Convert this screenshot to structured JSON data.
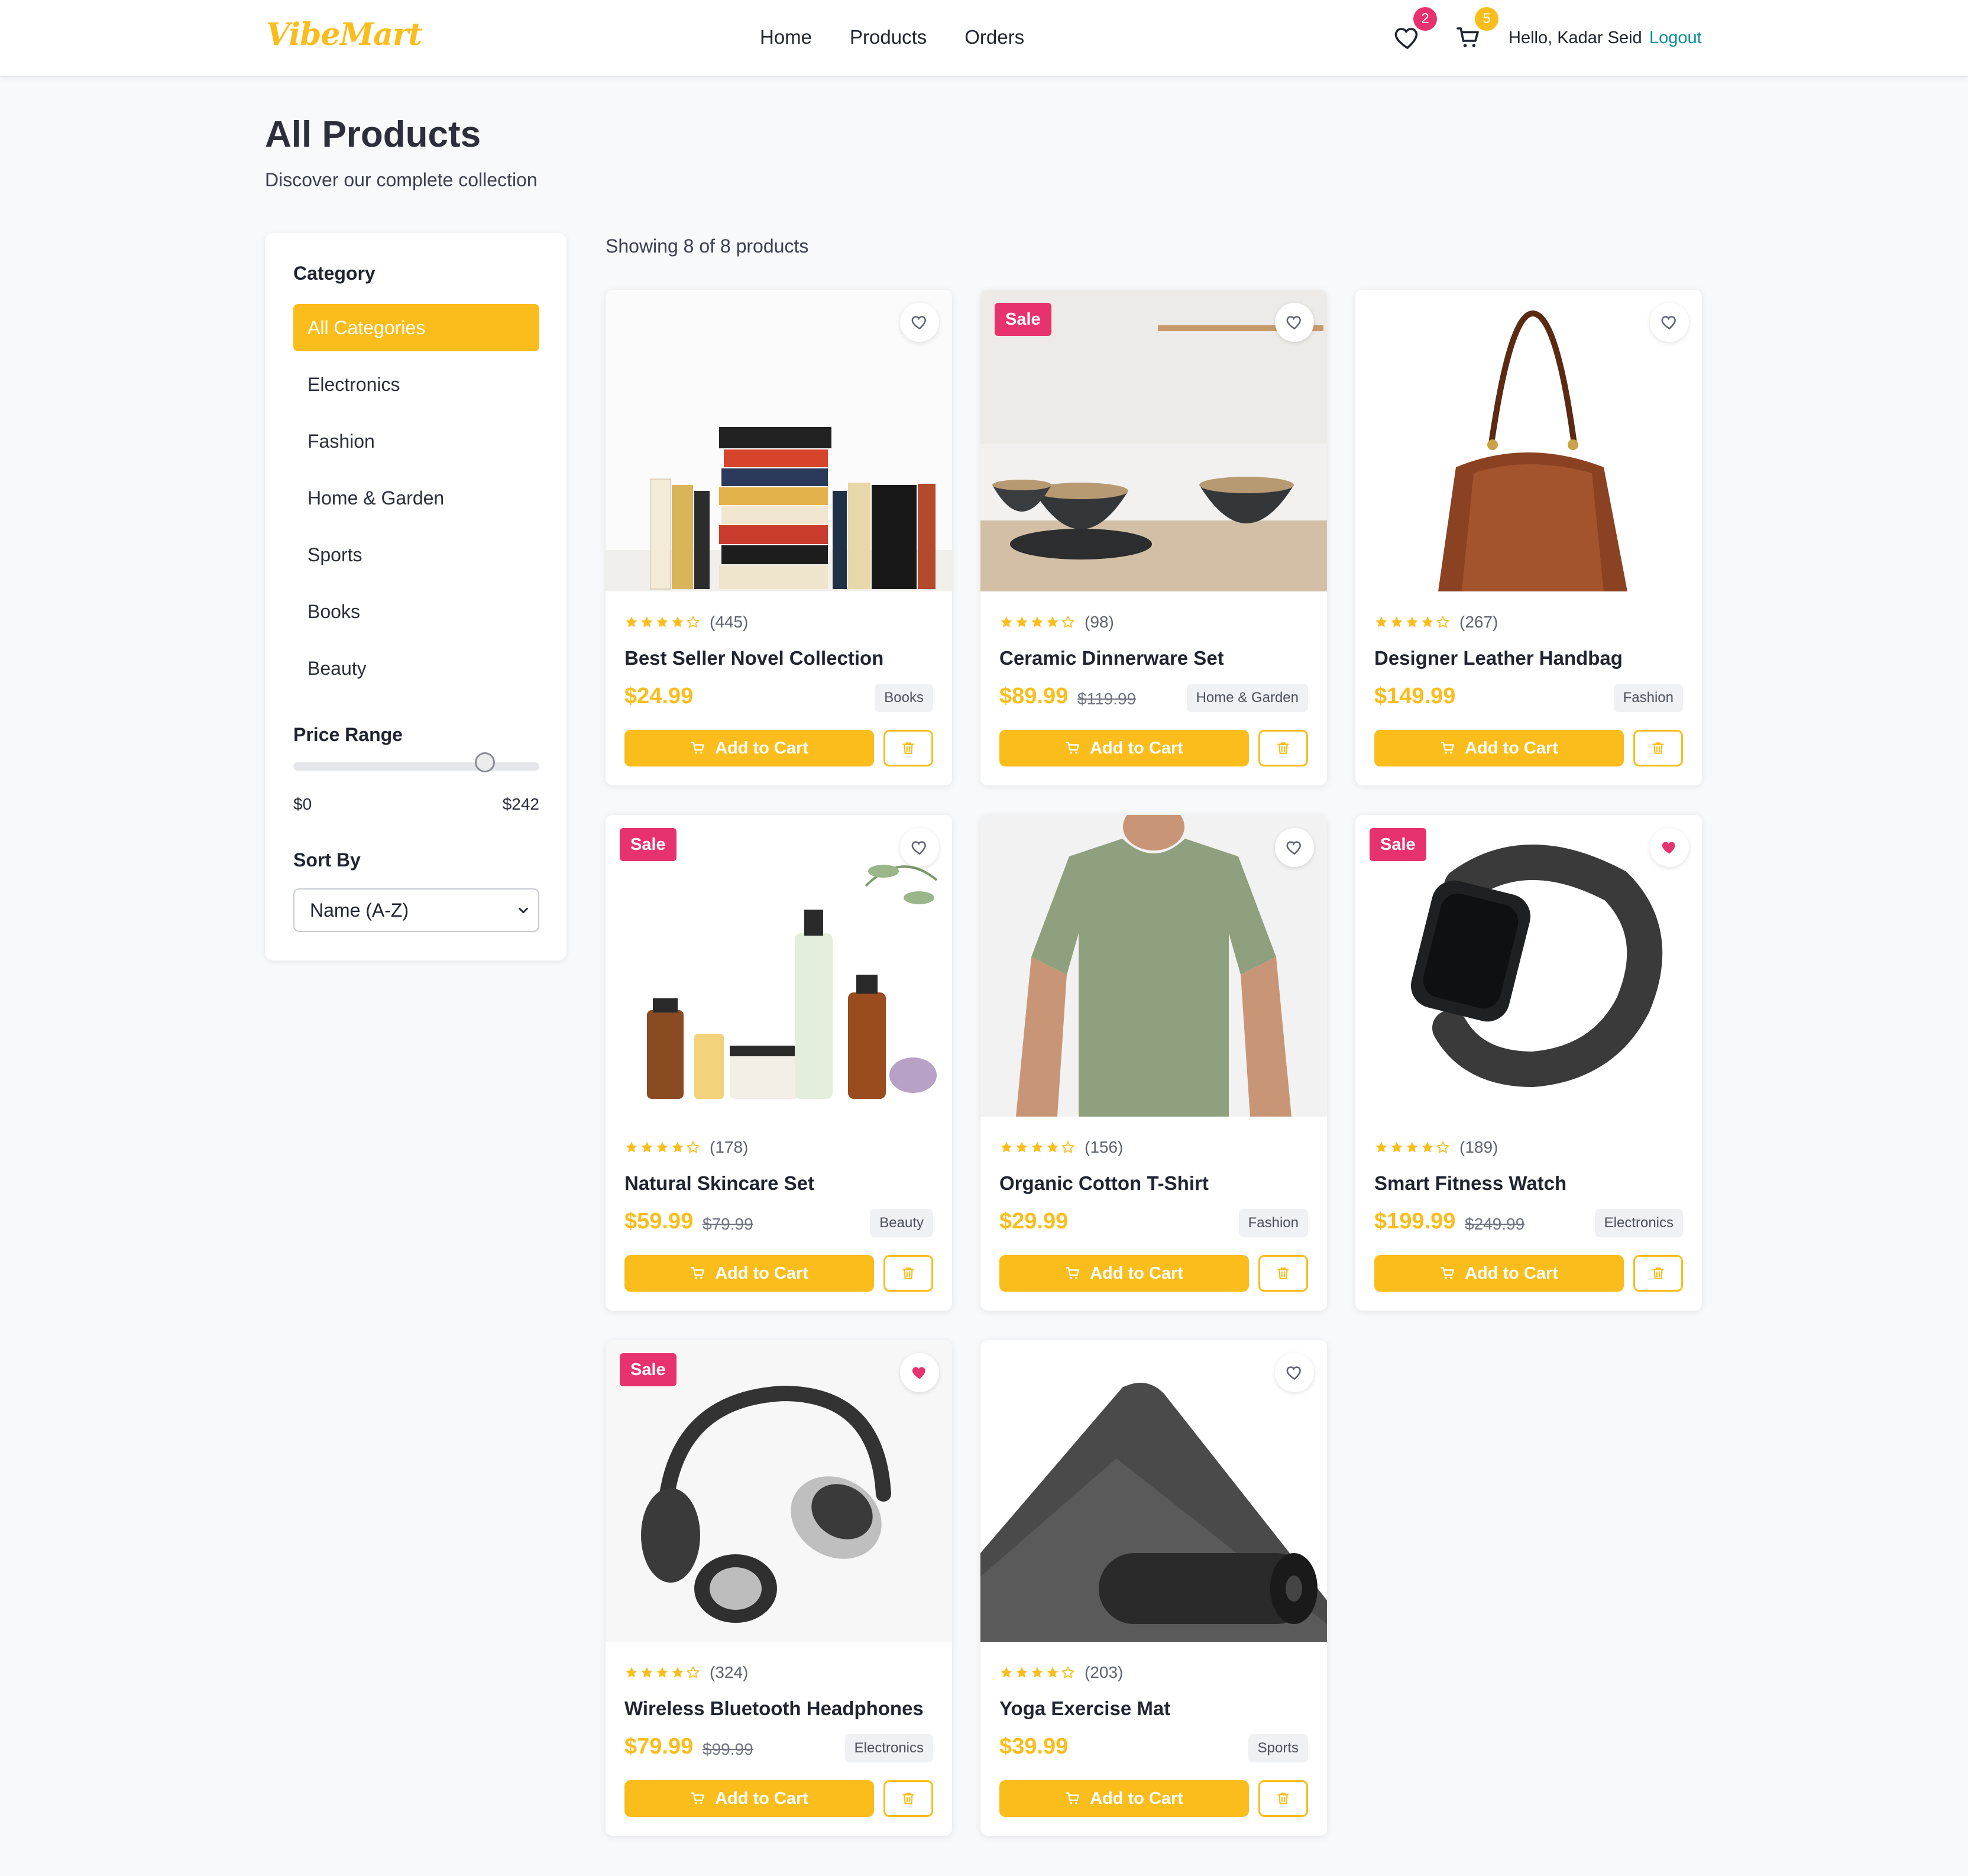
{
  "header": {
    "logo": "VibeMart",
    "nav": [
      "Home",
      "Products",
      "Orders"
    ],
    "wishlist_count": "2",
    "cart_count": "5",
    "greeting": "Hello, Kadar Seid",
    "logout": "Logout"
  },
  "page": {
    "title": "All Products",
    "subtitle": "Discover our complete collection"
  },
  "sidebar": {
    "category_heading": "Category",
    "categories": [
      "All Categories",
      "Electronics",
      "Fashion",
      "Home & Garden",
      "Sports",
      "Books",
      "Beauty"
    ],
    "selected_category": "All Categories",
    "price_heading": "Price Range",
    "price_min": "$0",
    "price_max": "$242",
    "price_slider_fraction": 0.78,
    "sort_heading": "Sort By",
    "sort_value": "Name (A-Z)"
  },
  "listing": {
    "showing": "Showing 8 of 8 products",
    "add_to_cart": "Add to Cart",
    "sale_label": "Sale"
  },
  "products": [
    {
      "name": "Best Seller Novel Collection",
      "price": "$24.99",
      "old_price": "",
      "category": "Books",
      "reviews": "(445)",
      "rating": 4,
      "sale": false,
      "favorite": false,
      "image": "books-image"
    },
    {
      "name": "Ceramic Dinnerware Set",
      "price": "$89.99",
      "old_price": "$119.99",
      "category": "Home & Garden",
      "reviews": "(98)",
      "rating": 4,
      "sale": true,
      "favorite": false,
      "image": "dinnerware-image"
    },
    {
      "name": "Designer Leather Handbag",
      "price": "$149.99",
      "old_price": "",
      "category": "Fashion",
      "reviews": "(267)",
      "rating": 4,
      "sale": false,
      "favorite": false,
      "image": "handbag-image"
    },
    {
      "name": "Natural Skincare Set",
      "price": "$59.99",
      "old_price": "$79.99",
      "category": "Beauty",
      "reviews": "(178)",
      "rating": 4,
      "sale": true,
      "favorite": false,
      "image": "skincare-image"
    },
    {
      "name": "Organic Cotton T-Shirt",
      "price": "$29.99",
      "old_price": "",
      "category": "Fashion",
      "reviews": "(156)",
      "rating": 4,
      "sale": false,
      "favorite": false,
      "image": "tshirt-image"
    },
    {
      "name": "Smart Fitness Watch",
      "price": "$199.99",
      "old_price": "$249.99",
      "category": "Electronics",
      "reviews": "(189)",
      "rating": 4,
      "sale": true,
      "favorite": true,
      "image": "smartwatch-image"
    },
    {
      "name": "Wireless Bluetooth Headphones",
      "price": "$79.99",
      "old_price": "$99.99",
      "category": "Electronics",
      "reviews": "(324)",
      "rating": 4,
      "sale": true,
      "favorite": true,
      "image": "headphones-image"
    },
    {
      "name": "Yoga Exercise Mat",
      "price": "$39.99",
      "old_price": "",
      "category": "Sports",
      "reviews": "(203)",
      "rating": 4,
      "sale": false,
      "favorite": false,
      "image": "yoga-mat-image"
    }
  ],
  "colors": {
    "accent": "#fbbd1b",
    "sale": "#e8316f",
    "link": "#0b8f98",
    "favorite": "#e8316f"
  }
}
